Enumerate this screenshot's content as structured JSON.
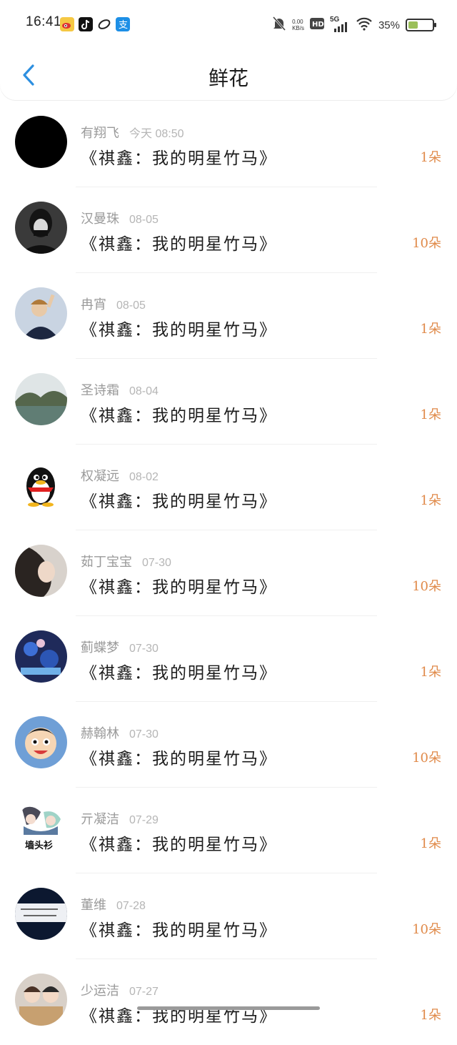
{
  "status_bar": {
    "time": "16:41",
    "network_speed": "0.00\nKB/s",
    "network": "5G",
    "battery": "35%",
    "battery_level": 0.35
  },
  "header": {
    "title": "鲜花",
    "back_icon": "chevron-left-icon"
  },
  "colors": {
    "accent": "#2d8fe0",
    "count": "#e08a4a",
    "name": "#9a9a9a"
  },
  "rows": [
    {
      "name": "有翔飞",
      "date": "今天 08:50",
      "book": "《祺鑫：我的明星竹马》",
      "count": "1朵"
    },
    {
      "name": "汉曼珠",
      "date": "08-05",
      "book": "《祺鑫：我的明星竹马》",
      "count": "10朵"
    },
    {
      "name": "冉宵",
      "date": "08-05",
      "book": "《祺鑫：我的明星竹马》",
      "count": "1朵"
    },
    {
      "name": "圣诗霜",
      "date": "08-04",
      "book": "《祺鑫：我的明星竹马》",
      "count": "1朵"
    },
    {
      "name": "权凝远",
      "date": "08-02",
      "book": "《祺鑫：我的明星竹马》",
      "count": "1朵"
    },
    {
      "name": "茹丁宝宝",
      "date": "07-30",
      "book": "《祺鑫：我的明星竹马》",
      "count": "10朵"
    },
    {
      "name": "蓟蝶梦",
      "date": "07-30",
      "book": "《祺鑫：我的明星竹马》",
      "count": "1朵"
    },
    {
      "name": "赫翰林",
      "date": "07-30",
      "book": "《祺鑫：我的明星竹马》",
      "count": "10朵"
    },
    {
      "name": "亓凝洁",
      "date": "07-29",
      "book": "《祺鑫：我的明星竹马》",
      "count": "1朵",
      "avatar_caption": "墙头衫"
    },
    {
      "name": "董维",
      "date": "07-28",
      "book": "《祺鑫：我的明星竹马》",
      "count": "10朵"
    },
    {
      "name": "少运洁",
      "date": "07-27",
      "book": "《祺鑫：我的明星竹马》",
      "count": "1朵"
    }
  ]
}
